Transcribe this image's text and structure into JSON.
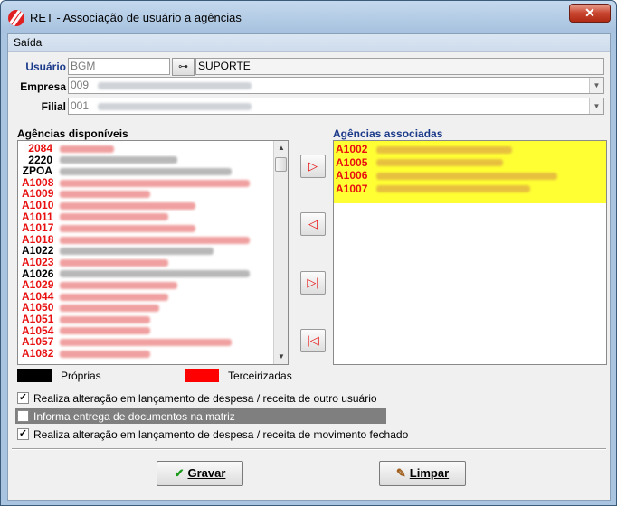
{
  "window": {
    "title": "RET -  Associação de usuário a agências",
    "close_label": "✕"
  },
  "menu": {
    "items": [
      "Saída"
    ]
  },
  "form": {
    "usuario_label": "Usuário",
    "usuario_code": "BGM",
    "usuario_name": "SUPORTE",
    "empresa_label": "Empresa",
    "empresa_code": "009",
    "filial_label": "Filial",
    "filial_code": "001"
  },
  "available": {
    "title": "Agências disponíveis",
    "rows": [
      {
        "code": "2084",
        "color": "red"
      },
      {
        "code": "2220",
        "color": "black"
      },
      {
        "code": "ZPOA",
        "color": "black"
      },
      {
        "code": "A1008",
        "color": "red"
      },
      {
        "code": "A1009",
        "color": "red"
      },
      {
        "code": "A1010",
        "color": "red"
      },
      {
        "code": "A1011",
        "color": "red"
      },
      {
        "code": "A1017",
        "color": "red"
      },
      {
        "code": "A1018",
        "color": "red"
      },
      {
        "code": "A1022",
        "color": "black"
      },
      {
        "code": "A1023",
        "color": "red"
      },
      {
        "code": "A1026",
        "color": "black"
      },
      {
        "code": "A1029",
        "color": "red"
      },
      {
        "code": "A1044",
        "color": "red"
      },
      {
        "code": "A1050",
        "color": "red"
      },
      {
        "code": "A1051",
        "color": "red"
      },
      {
        "code": "A1054",
        "color": "red"
      },
      {
        "code": "A1057",
        "color": "red"
      },
      {
        "code": "A1082",
        "color": "red"
      }
    ]
  },
  "associated": {
    "title": "Agências associadas",
    "rows": [
      "A1002",
      "A1005",
      "A1006",
      "A1007"
    ]
  },
  "legend": {
    "own_label": "Próprias",
    "own_color": "#000000",
    "third_label": "Terceirizadas",
    "third_color": "#ff0000"
  },
  "options": {
    "opt1_label": "Realiza alteração em lançamento de despesa / receita de outro usuário",
    "opt2_label": "Informa entrega de documentos na matriz",
    "opt3_label": "Realiza alteração em lançamento de despesa / receita de movimento fechado"
  },
  "buttons": {
    "save_label": "Gravar",
    "clear_label": "Limpar"
  }
}
